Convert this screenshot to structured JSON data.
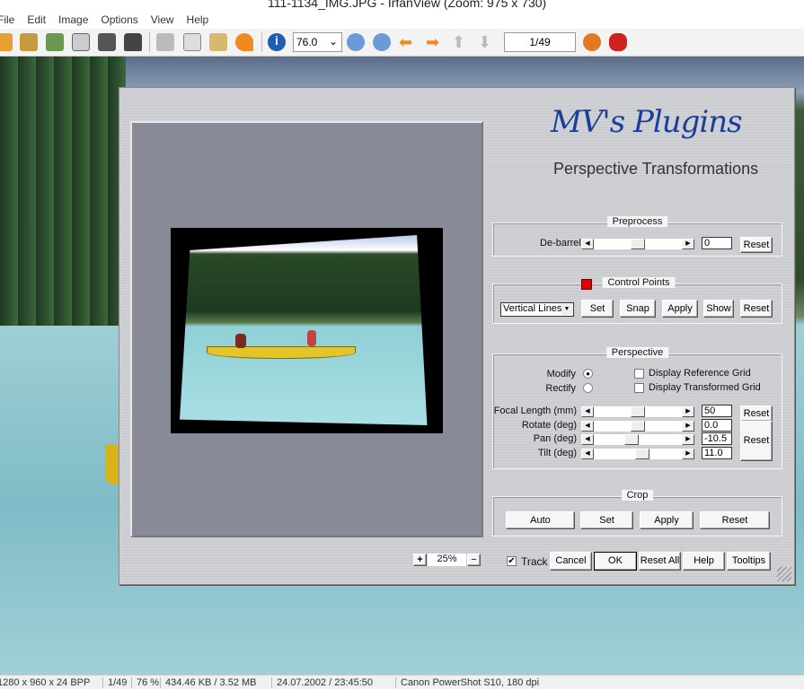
{
  "window": {
    "title": "111-1134_IMG.JPG - IrfanView (Zoom: 975 x 730)"
  },
  "menu": [
    "File",
    "Edit",
    "Image",
    "Options",
    "View",
    "Help"
  ],
  "toolbar": {
    "zoom_value": "76.0",
    "page": "1/49",
    "icons": [
      "open-icon",
      "thumbnails-icon",
      "slideshow-icon",
      "save-icon",
      "print-icon",
      "delete-icon",
      "cut-icon",
      "copy-icon",
      "paste-icon",
      "undo-icon",
      "info-icon",
      "zoom-in-icon",
      "zoom-out-icon",
      "previous-icon",
      "next-icon",
      "first-icon",
      "last-icon",
      "options-icon",
      "about-icon"
    ]
  },
  "status": {
    "dims": "1280 x 960 x 24 BPP",
    "page": "1/49",
    "zoom": "76 %",
    "size": "434.46 KB / 3.52 MB",
    "date": "24.07.2002 / 23:45:50",
    "camera": "Canon PowerShot S10, 180 dpi"
  },
  "dialog": {
    "logo": "MV's Plugins",
    "subtitle": "Perspective Transformations",
    "preprocess": {
      "label": "Preprocess",
      "debarrel_label": "De-barrel",
      "debarrel_value": "0",
      "debarrel_pos": 0.5,
      "reset": "Reset"
    },
    "control_points": {
      "label": "Control Points",
      "marker_color": "#e00000",
      "mode": "Vertical Lines",
      "set": "Set",
      "snap": "Snap",
      "apply": "Apply",
      "show": "Show",
      "reset": "Reset"
    },
    "perspective": {
      "label": "Perspective",
      "modify": "Modify",
      "rectify": "Rectify",
      "mode": "Modify",
      "ref_grid": "Display Reference Grid",
      "ref_grid_checked": false,
      "trans_grid": "Display Transformed Grid",
      "trans_grid_checked": false,
      "sliders": [
        {
          "label": "Focal Length (mm)",
          "value": "50",
          "pos": 0.5
        },
        {
          "label": "Rotate (deg)",
          "value": "0.0",
          "pos": 0.5
        },
        {
          "label": "Pan (deg)",
          "value": "-10.5",
          "pos": 0.42
        },
        {
          "label": "Tilt (deg)",
          "value": "11.0",
          "pos": 0.56
        }
      ],
      "reset1": "Reset",
      "reset2": "Reset"
    },
    "crop": {
      "label": "Crop",
      "auto": "Auto",
      "set": "Set",
      "apply": "Apply",
      "reset": "Reset"
    },
    "bottom": {
      "zoom_plus": "+",
      "zoom": "25%",
      "zoom_minus": "−",
      "track": "Track",
      "track_checked": true,
      "cancel": "Cancel",
      "ok": "OK",
      "reset_all": "Reset All",
      "help": "Help",
      "tooltips": "Tooltips"
    }
  }
}
